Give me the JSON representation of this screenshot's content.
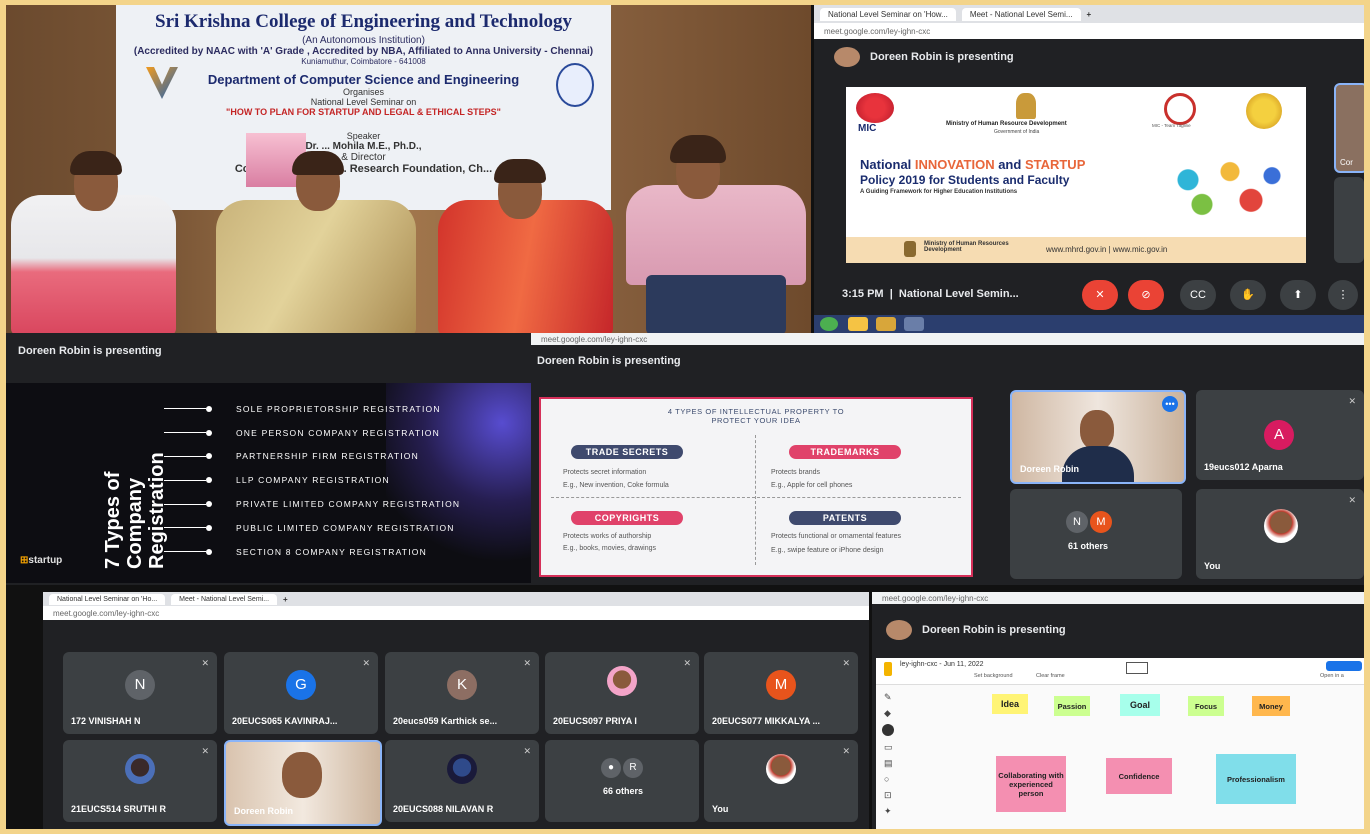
{
  "photo": {
    "banner": {
      "college": "Sri Krishna College of Engineering and Technology",
      "autonomous": "(An Autonomous Institution)",
      "accreditation": "(Accredited by NAAC with 'A' Grade , Accredited by NBA, Affiliated to Anna University - Chennai)",
      "address": "Kuniamuthur, Coimbatore - 641008",
      "department": "Department of Computer Science and Engineering",
      "organises": "Organises",
      "seminar_level": "National Level Seminar on",
      "seminar_title": "\"HOW TO PLAN FOR STARTUP AND LEGAL & ETHICAL STEPS\"",
      "speaker_label": "Speaker",
      "speaker_name": "Dr. ... Mohila M.E., Ph.D.,",
      "speaker_role": "& Director",
      "speaker_org": "Compuinnovations ... Research Foundation, Ch..."
    }
  },
  "top_meet": {
    "tabs": [
      "National Level Seminar on 'How...",
      "Meet - National Level Semi..."
    ],
    "url": "meet.google.com/ley-ighn-cxc",
    "presenting": "Doreen Robin is presenting",
    "slide": {
      "mic": "MIC",
      "ministry": "Ministry of Human Resource Development",
      "govt": "Government of India",
      "aicte": "MIC - Team Tagline",
      "title_pre": "National ",
      "title_innov": "INNOVATION",
      "title_and": " and ",
      "title_startup": "STARTUP",
      "title_line2": "Policy 2019 for Students and Faculty",
      "subtitle": "A Guiding Framework for Higher Education Institutions",
      "footer_ministry": "Ministry of Human Resources Development",
      "footer_urls": "www.mhrd.gov.in | www.mic.gov.in"
    },
    "time": "3:15 PM",
    "meeting_name": "National Level Semin...",
    "peek_label": "Cor"
  },
  "left_meet": {
    "presenting": "Doreen Robin is presenting",
    "slide_title": "7 Types of Company Registration",
    "items": [
      "SOLE PROPRIETORSHIP REGISTRATION",
      "ONE PERSON COMPANY REGISTRATION",
      "PARTNERSHIP FIRM REGISTRATION",
      "LLP COMPANY REGISTRATION",
      "PRIVATE LIMITED COMPANY REGISTRATION",
      "PUBLIC LIMITED COMPANY REGISTRATION",
      "SECTION 8 COMPANY REGISTRATION"
    ],
    "brand": "startup"
  },
  "mid_meet": {
    "url": "meet.google.com/ley-ighn-cxc",
    "presenting": "Doreen Robin is presenting",
    "slide": {
      "heading1": "4 TYPES OF INTELLECTUAL PROPERTY TO",
      "heading2": "PROTECT YOUR IDEA",
      "boxes": [
        {
          "label": "TRADE SECRETS",
          "items": [
            "Protects secret information",
            "E.g., New invention, Coke formula"
          ]
        },
        {
          "label": "TRADEMARKS",
          "items": [
            "Protects brands",
            "E.g., Apple for cell phones"
          ]
        },
        {
          "label": "COPYRIGHTS",
          "items": [
            "Protects works of authorship",
            "E.g., books, movies, drawings"
          ]
        },
        {
          "label": "PATENTS",
          "items": [
            "Protects functional or ornamental features",
            "E.g., swipe feature or iPhone design"
          ]
        }
      ]
    },
    "tiles": [
      {
        "name": "Doreen Robin"
      },
      {
        "name": "19eucs012 Aparna",
        "letter": "A"
      },
      {
        "name": "61 others",
        "letters": [
          "N",
          "M"
        ]
      },
      {
        "name": "You"
      }
    ]
  },
  "bottom_meet": {
    "tabs": [
      "National Level Seminar on 'Ho...",
      "Meet - National Level Semi..."
    ],
    "url": "meet.google.com/ley-ighn-cxc",
    "tiles": [
      {
        "name": "172 VINISHAH N",
        "letter": "N",
        "color": "#5f6368"
      },
      {
        "name": "20EUCS065 KAVINRAJ...",
        "letter": "G",
        "color": "#1a73e8"
      },
      {
        "name": "20eucs059 Karthick se...",
        "letter": "K",
        "color": "#8d6e63"
      },
      {
        "name": "20EUCS097 PRIYA I"
      },
      {
        "name": "20EUCS077 MIKKALYA ...",
        "letter": "M",
        "color": "#e8541c"
      },
      {
        "name": "21EUCS514 SRUTHI R"
      },
      {
        "name": "Doreen Robin"
      },
      {
        "name": "20EUCS088 NILAVAN R"
      },
      {
        "name": "66 others",
        "letters": [
          "R"
        ]
      },
      {
        "name": "You"
      }
    ]
  },
  "right_meet": {
    "url": "meet.google.com/ley-ighn-cxc",
    "presenting": "Doreen Robin is presenting",
    "jamboard": {
      "title": "ley-ighn-cxc - Jun 11, 2022",
      "set_background": "Set background",
      "clear_frame": "Clear frame",
      "open_label": "Open in a",
      "stickies": [
        "Idea",
        "Passion",
        "Goal",
        "Focus",
        "Money",
        "Collaborating with experienced person",
        "Confidence",
        "Professionalism"
      ]
    }
  }
}
